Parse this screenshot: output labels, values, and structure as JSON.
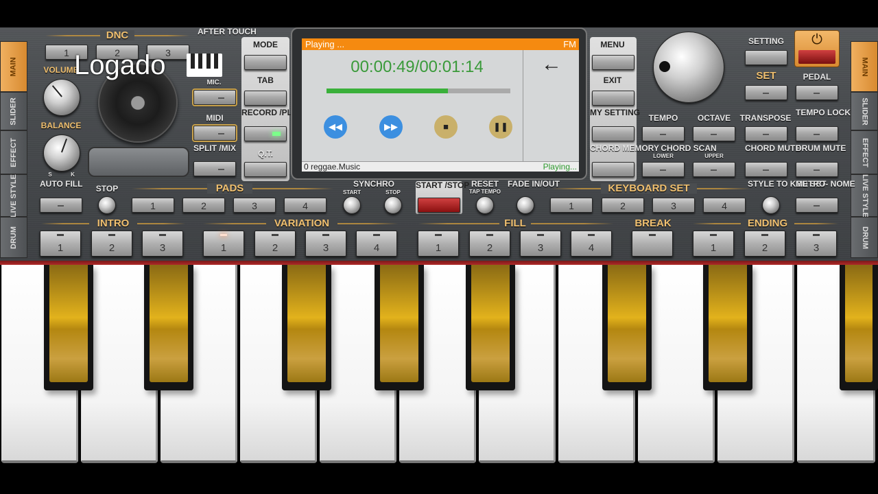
{
  "overlay": {
    "watermark": "Logado"
  },
  "side_tabs": {
    "left": [
      "MAIN",
      "SLIDER",
      "EFFECT",
      "LIVE STYLE",
      "DRUM"
    ],
    "right": [
      "MAIN",
      "SLIDER",
      "EFFECT",
      "LIVE STYLE",
      "DRUM"
    ],
    "active": "MAIN"
  },
  "dnc": {
    "title": "DNC",
    "buttons": [
      "1",
      "2",
      "3"
    ]
  },
  "labels": {
    "after_touch": "AFTER TOUCH",
    "volume": "VOLUME",
    "balance": "BALANCE",
    "balance_s": "S",
    "balance_k": "K",
    "mic": "MIC.",
    "midi": "MIDI",
    "split_mix": "SPLIT /MIX"
  },
  "left_col": {
    "mode": "MODE",
    "tab": "TAB",
    "record_play": "RECORD /PLAY",
    "qt": "Q.T."
  },
  "right_col": {
    "menu": "MENU",
    "exit": "EXIT",
    "my_setting": "MY SETTING",
    "chord_memory": "CHORD MEMORY"
  },
  "screen": {
    "status": "Playing ...",
    "band": "FM",
    "time": "00:00:49/00:01:14",
    "progress": 0.66,
    "back_icon": "arrow-left-icon",
    "file": "0 reggae.Music",
    "playing": "Playing..."
  },
  "transport_icons": [
    "rewind-icon",
    "fast-forward-icon",
    "stop-icon",
    "pause-icon"
  ],
  "top_right": {
    "setting": "SETTING",
    "set": "SET",
    "pedal": "PEDAL",
    "power_icon": "power-icon"
  },
  "controls": {
    "tempo": "TEMPO",
    "octave": "OCTAVE",
    "transpose": "TRANSPOSE",
    "tempo_lock": "TEMPO LOCK",
    "chord_scan": "CHORD SCAN",
    "lower": "LOWER",
    "upper": "UPPER",
    "chord_mute": "CHORD MUTE",
    "drum_mute": "DRUM MUTE"
  },
  "row3": {
    "auto_fill": "AUTO FILL",
    "stop": "STOP",
    "pads": "PADS",
    "pad_buttons": [
      "1",
      "2",
      "3",
      "4"
    ],
    "synchro": "SYNCHRO",
    "synchro_start": "START",
    "synchro_stop": "STOP",
    "start_stop": "START /STOP",
    "reset": "RESET",
    "tap_tempo": "TAP TEMPO",
    "fade": "FADE IN/OUT",
    "keyboard_set": "KEYBOARD SET",
    "kbd_buttons": [
      "1",
      "2",
      "3",
      "4"
    ],
    "style_to_kbd": "STYLE TO KBD SET",
    "metronome": "METRO- NOME"
  },
  "sections": {
    "intro": {
      "title": "INTRO",
      "buttons": [
        "1",
        "2",
        "3"
      ]
    },
    "variation": {
      "title": "VARIATION",
      "buttons": [
        "1",
        "2",
        "3",
        "4"
      ]
    },
    "fill": {
      "title": "FILL",
      "buttons": [
        "1",
        "2",
        "3",
        "4"
      ]
    },
    "break": {
      "title": "BREAK"
    },
    "ending": {
      "title": "ENDING",
      "buttons": [
        "1",
        "2",
        "3"
      ]
    }
  }
}
